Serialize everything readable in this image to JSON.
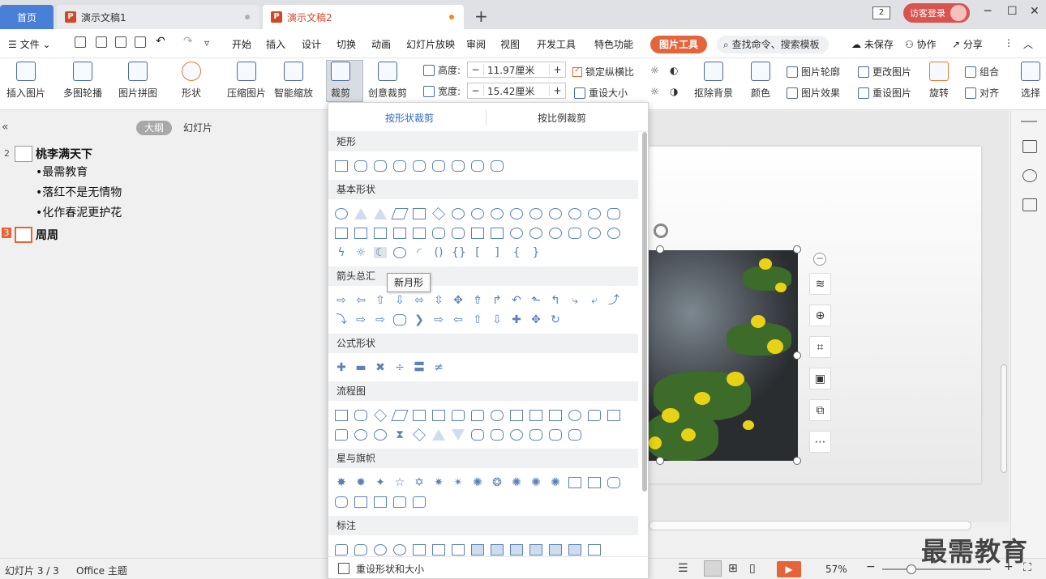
{
  "tabs": {
    "home": "首页",
    "doc1": "演示文稿1",
    "doc2": "演示文稿2",
    "doc_icon": "P",
    "window_count": "2",
    "login": "访客登录"
  },
  "menu": {
    "file": "文件",
    "items": [
      "开始",
      "插入",
      "设计",
      "切换",
      "动画",
      "幻灯片放映",
      "审阅",
      "视图",
      "开发工具",
      "特色功能"
    ],
    "picture_tools": "图片工具",
    "search_placeholder": "查找命令、搜索模板",
    "unsaved": "未保存",
    "collaborate": "协作",
    "share": "分享"
  },
  "ribbon": {
    "insert_picture": "插入图片",
    "multi_carousel": "多图轮播",
    "picture_collage": "图片拼图",
    "shape": "形状",
    "compress": "压缩图片",
    "smart_scale": "智能缩放",
    "crop": "裁剪",
    "creative_crop": "创意裁剪",
    "height_label": "高度:",
    "height_value": "11.97厘米",
    "width_label": "宽度:",
    "width_value": "15.42厘米",
    "lock_ratio": "锁定纵横比",
    "reset_size": "重设大小",
    "remove_bg": "抠除背景",
    "color": "颜色",
    "picture_outline": "图片轮廓",
    "picture_effect": "图片效果",
    "change_picture": "更改图片",
    "reset_picture": "重设图片",
    "rotate": "旋转",
    "group": "组合",
    "align": "对齐",
    "select": "选择"
  },
  "outline": {
    "tab_outline": "大纲",
    "tab_slides": "幻灯片",
    "slides": [
      {
        "num": "2",
        "title": "桃李满天下",
        "bullets": [
          "•最需教育",
          "•落红不是无情物",
          "•化作春泥更护花"
        ]
      },
      {
        "num": "3",
        "title": "周周",
        "bullets": []
      }
    ]
  },
  "crop_menu": {
    "tab_shape": "按形状裁剪",
    "tab_ratio": "按比例裁剪",
    "categories": [
      "矩形",
      "基本形状",
      "箭头总汇",
      "公式形状",
      "流程图",
      "星与旗帜",
      "标注"
    ],
    "tooltip": "新月形",
    "reset": "重设形状和大小"
  },
  "status": {
    "slide_info": "幻灯片 3 / 3",
    "theme": "Office 主题",
    "zoom": "57%"
  },
  "watermark": "最需教育",
  "colors": {
    "accent": "#e6643a",
    "home_tab": "#4a7fd8",
    "selection_blue": "#2f6ebd"
  }
}
